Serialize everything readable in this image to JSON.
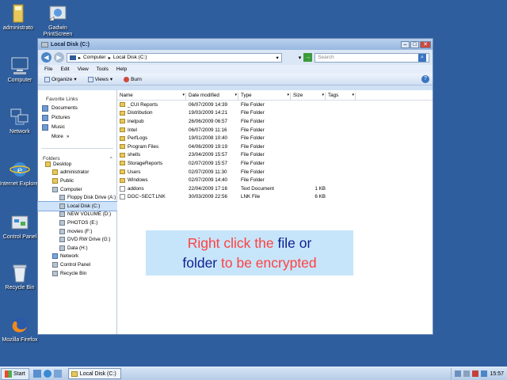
{
  "desktop_icons": [
    {
      "label": "administrato",
      "icon": "user-folder-icon"
    },
    {
      "label": "Gadwin PrintScreen",
      "icon": "printscreen-app-icon"
    },
    {
      "label": "Computer",
      "icon": "computer-icon"
    },
    {
      "label": "Network",
      "icon": "network-icon"
    },
    {
      "label": "Internet Explorer",
      "icon": "internet-explorer-icon"
    },
    {
      "label": "Control Panel",
      "icon": "control-panel-icon"
    },
    {
      "label": "Recycle Bin",
      "icon": "recycle-bin-icon"
    },
    {
      "label": "Mozilla Firefox",
      "icon": "firefox-icon"
    }
  ],
  "window": {
    "title": "Local Disk (C:)",
    "address": [
      "Computer",
      "Local Disk (C:)"
    ],
    "search_placeholder": "Search",
    "menu": [
      "File",
      "Edit",
      "View",
      "Tools",
      "Help"
    ],
    "toolbar": {
      "organize": "Organize",
      "views": "Views",
      "burn": "Burn"
    },
    "favorites_header": "Favorite Links",
    "favorites": [
      "Documents",
      "Pictures",
      "Music",
      "More"
    ],
    "folders_header": "Folders",
    "tree": [
      {
        "label": "Desktop",
        "indent": 1,
        "kind": "folder"
      },
      {
        "label": "administrator",
        "indent": 2,
        "kind": "folder"
      },
      {
        "label": "Public",
        "indent": 2,
        "kind": "folder"
      },
      {
        "label": "Computer",
        "indent": 2,
        "kind": "drive"
      },
      {
        "label": "Floppy Disk Drive (A:)",
        "indent": 3,
        "kind": "drive"
      },
      {
        "label": "Local Disk (C:)",
        "indent": 3,
        "kind": "drive",
        "selected": true
      },
      {
        "label": "NEW VOLUME (D:)",
        "indent": 3,
        "kind": "drive"
      },
      {
        "label": "PHOTOS (E:)",
        "indent": 3,
        "kind": "drive"
      },
      {
        "label": "movies (F:)",
        "indent": 3,
        "kind": "drive"
      },
      {
        "label": "DVD RW Drive (G:)",
        "indent": 3,
        "kind": "drive"
      },
      {
        "label": "Data (H:)",
        "indent": 3,
        "kind": "drive"
      },
      {
        "label": "Network",
        "indent": 2,
        "kind": "net"
      },
      {
        "label": "Control Panel",
        "indent": 2,
        "kind": "drive"
      },
      {
        "label": "Recycle Bin",
        "indent": 2,
        "kind": "drive"
      }
    ],
    "columns": [
      "Name",
      "Date modified",
      "Type",
      "Size",
      "Tags"
    ],
    "files": [
      {
        "name": "_CUI Reports",
        "date": "06/07/2009 14:39",
        "type": "File Folder",
        "size": "",
        "doc": false
      },
      {
        "name": "Distribution",
        "date": "19/03/2009 14:21",
        "type": "File Folder",
        "size": "",
        "doc": false
      },
      {
        "name": "inetpub",
        "date": "26/06/2009 06:57",
        "type": "File Folder",
        "size": "",
        "doc": false
      },
      {
        "name": "Intel",
        "date": "06/07/2009 11:16",
        "type": "File Folder",
        "size": "",
        "doc": false
      },
      {
        "name": "PerfLogs",
        "date": "19/01/2008 10:40",
        "type": "File Folder",
        "size": "",
        "doc": false
      },
      {
        "name": "Program Files",
        "date": "04/06/2009 19:19",
        "type": "File Folder",
        "size": "",
        "doc": false
      },
      {
        "name": "shells",
        "date": "23/04/2009 15:57",
        "type": "File Folder",
        "size": "",
        "doc": false
      },
      {
        "name": "StorageReports",
        "date": "02/07/2009 15:57",
        "type": "File Folder",
        "size": "",
        "doc": false
      },
      {
        "name": "Users",
        "date": "02/07/2009 11:30",
        "type": "File Folder",
        "size": "",
        "doc": false
      },
      {
        "name": "Windows",
        "date": "02/07/2009 14:40",
        "type": "File Folder",
        "size": "",
        "doc": false
      },
      {
        "name": "addons",
        "date": "22/04/2009 17:16",
        "type": "Text Document",
        "size": "1 KB",
        "doc": true
      },
      {
        "name": "DOC~SECT.LNK",
        "date": "30/03/2009 22:56",
        "type": "LNK File",
        "size": "6 KB",
        "doc": true
      }
    ]
  },
  "caption": {
    "part1": "Right click the ",
    "part2": "file",
    "part3": " or",
    "part4": "folder",
    "part5": " to be encrypted"
  },
  "taskbar": {
    "start_label": "Start",
    "task_label": "Local Disk (C:)",
    "clock": "15:57"
  }
}
